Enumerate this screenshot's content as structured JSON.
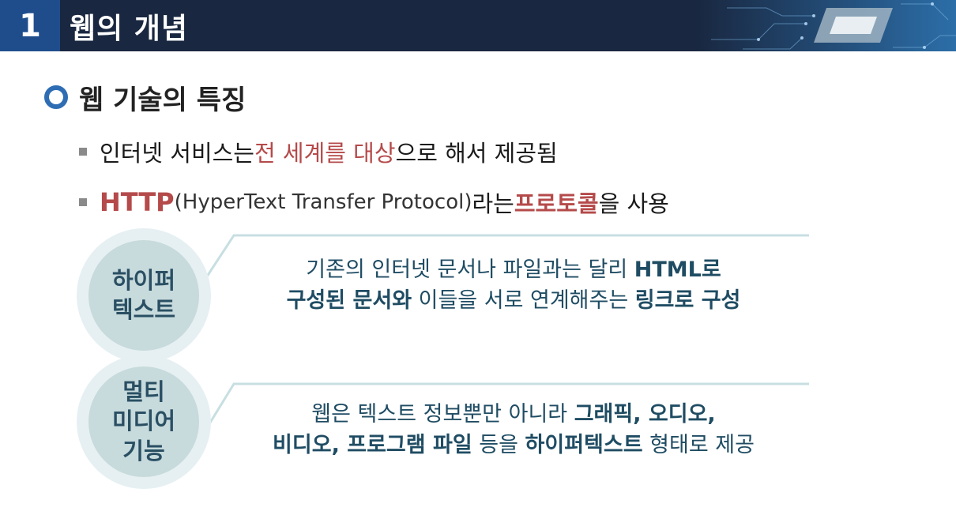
{
  "header": {
    "number": "1",
    "title": "웹의 개념"
  },
  "section": {
    "title": "웹 기술의 특징"
  },
  "bullets": [
    {
      "text_a": "인터넷 서비스는 ",
      "highlight": "전 세계를 대상",
      "text_b": "으로 해서 제공됨"
    },
    {
      "highlight_a": "HTTP",
      "paren": "(HyperText Transfer Protocol)",
      "text_a": "라는 ",
      "highlight_b": "프로토콜",
      "text_b": "을 사용"
    }
  ],
  "cards": [
    {
      "label_lines": [
        "하이퍼",
        "텍스트"
      ],
      "line1": {
        "t1": "기존의 인터넷 문서나 파일과는 달리 ",
        "b1": "HTML로"
      },
      "line2": {
        "b1": "구성된 문서와",
        "t1": " 이들을 서로 연계해주는 ",
        "b2": "링크로 구성"
      }
    },
    {
      "label_lines": [
        "멀티",
        "미디어",
        "기능"
      ],
      "line1": {
        "t1": "웹은 텍스트 정보뿐만 아니라 ",
        "b1": "그래픽, 오디오,"
      },
      "line2": {
        "b1": "비디오, 프로그램 파일",
        "t1": " 등을 ",
        "b2": "하이퍼텍스트",
        "t2": " 형태로 제공"
      }
    }
  ],
  "colors": {
    "header_bg": "#192740",
    "number_bg": "#1f4d8c",
    "accent_red": "#b54a4a",
    "card_text": "#1f4c63"
  }
}
